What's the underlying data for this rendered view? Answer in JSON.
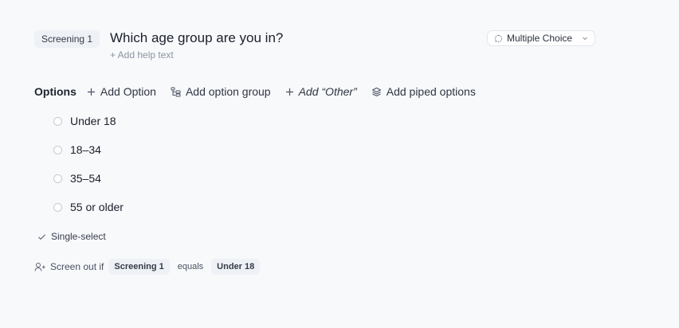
{
  "question": {
    "badge": "Screening 1",
    "title": "Which age group are you in?",
    "help_text": "+ Add help text",
    "type_label": "Multiple Choice"
  },
  "toolbar": {
    "heading": "Options",
    "add_option": "Add Option",
    "add_group": "Add option group",
    "add_other": "Add “Other”",
    "add_piped": "Add piped options"
  },
  "options": [
    "Under 18",
    "18–34",
    "35–54",
    "55 or older"
  ],
  "select_mode": "Single-select",
  "screen_out": {
    "prefix": "Screen out if",
    "field": "Screening 1",
    "operator": "equals",
    "value": "Under 18"
  },
  "colors": {
    "text": "#1f2430",
    "muted": "#8a93a3",
    "chip_bg": "#eef1f5",
    "page_bg": "#f8f9fb"
  }
}
